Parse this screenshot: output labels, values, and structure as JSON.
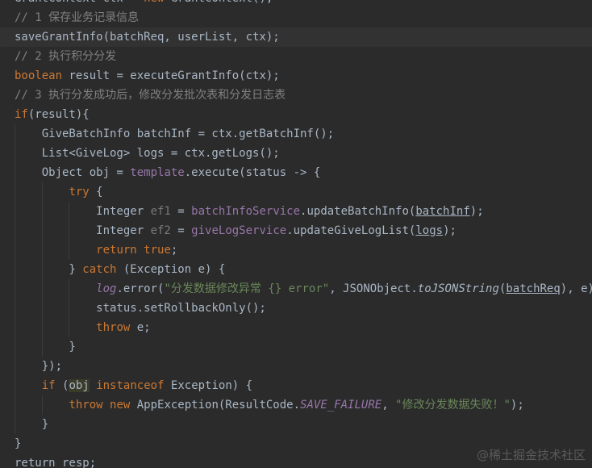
{
  "editor": {
    "lines": [
      [
        {
          "t": "GrantContext ctx = ",
          "c": "text"
        },
        {
          "t": "new ",
          "c": "keyword"
        },
        {
          "t": "GrantContext();",
          "c": "text"
        }
      ],
      [
        {
          "t": "// 1 保存业务记录信息",
          "c": "comment"
        }
      ],
      [
        {
          "t": "saveGrantInfo(batchReq, userList, ctx);",
          "c": "text"
        }
      ],
      [
        {
          "t": "// 2 执行积分分发",
          "c": "comment"
        }
      ],
      [
        {
          "t": "boolean ",
          "c": "keyword"
        },
        {
          "t": "result = executeGrantInfo(ctx);",
          "c": "text"
        }
      ],
      [
        {
          "t": "// 3 执行分发成功后，修改分发批次表和分发日志表",
          "c": "comment"
        }
      ],
      [
        {
          "t": "if",
          "c": "keyword"
        },
        {
          "t": "(result){",
          "c": "text"
        }
      ],
      [
        {
          "t": "    GiveBatchInfo batchInf = ctx.getBatchInf();",
          "c": "text"
        }
      ],
      [
        {
          "t": "    List<GiveLog> logs = ctx.getLogs();",
          "c": "text"
        }
      ],
      [
        {
          "t": "    Object obj = ",
          "c": "text"
        },
        {
          "t": "template",
          "c": "field"
        },
        {
          "t": ".execute(status -> {",
          "c": "text"
        }
      ],
      [
        {
          "t": "        ",
          "c": "text"
        },
        {
          "t": "try ",
          "c": "keyword"
        },
        {
          "t": "{",
          "c": "text"
        }
      ],
      [
        {
          "t": "            Integer ",
          "c": "text"
        },
        {
          "t": "ef1",
          "c": "gray"
        },
        {
          "t": " = ",
          "c": "text"
        },
        {
          "t": "batchInfoService",
          "c": "field"
        },
        {
          "t": ".updateBatchInfo(",
          "c": "text"
        },
        {
          "t": "batchInf",
          "c": "param"
        },
        {
          "t": ");",
          "c": "text"
        }
      ],
      [
        {
          "t": "            Integer ",
          "c": "text"
        },
        {
          "t": "ef2",
          "c": "gray"
        },
        {
          "t": " = ",
          "c": "text"
        },
        {
          "t": "giveLogService",
          "c": "field"
        },
        {
          "t": ".updateGiveLogList(",
          "c": "text"
        },
        {
          "t": "logs",
          "c": "param"
        },
        {
          "t": ");",
          "c": "text"
        }
      ],
      [
        {
          "t": "            ",
          "c": "text"
        },
        {
          "t": "return true",
          "c": "keyword"
        },
        {
          "t": ";",
          "c": "text"
        }
      ],
      [
        {
          "t": "        } ",
          "c": "text"
        },
        {
          "t": "catch ",
          "c": "keyword"
        },
        {
          "t": "(Exception e) {",
          "c": "text"
        }
      ],
      [
        {
          "t": "            ",
          "c": "text"
        },
        {
          "t": "log",
          "c": "const"
        },
        {
          "t": ".error(",
          "c": "text"
        },
        {
          "t": "\"分发数据修改异常 {} error\"",
          "c": "string"
        },
        {
          "t": ", JSONObject.",
          "c": "text"
        },
        {
          "t": "toJSONString",
          "c": "static"
        },
        {
          "t": "(",
          "c": "text"
        },
        {
          "t": "batchReq",
          "c": "param"
        },
        {
          "t": "), e);",
          "c": "text"
        }
      ],
      [
        {
          "t": "            status.setRollbackOnly();",
          "c": "text"
        }
      ],
      [
        {
          "t": "            ",
          "c": "text"
        },
        {
          "t": "throw ",
          "c": "keyword"
        },
        {
          "t": "e;",
          "c": "text"
        }
      ],
      [
        {
          "t": "        }",
          "c": "text"
        }
      ],
      [
        {
          "t": "    });",
          "c": "text"
        }
      ],
      [
        {
          "t": "    ",
          "c": "text"
        },
        {
          "t": "if ",
          "c": "keyword"
        },
        {
          "t": "(",
          "c": "text"
        },
        {
          "t": "obj",
          "c": "highlight"
        },
        {
          "t": " ",
          "c": "text"
        },
        {
          "t": "instanceof ",
          "c": "keyword"
        },
        {
          "t": "Exception) {",
          "c": "text"
        }
      ],
      [
        {
          "t": "        ",
          "c": "text"
        },
        {
          "t": "throw new ",
          "c": "keyword"
        },
        {
          "t": "AppException(ResultCode.",
          "c": "text"
        },
        {
          "t": "SAVE_FAILURE",
          "c": "const"
        },
        {
          "t": ", ",
          "c": "text"
        },
        {
          "t": "\"修改分发数据失败！\"",
          "c": "string"
        },
        {
          "t": ");",
          "c": "text"
        }
      ],
      [
        {
          "t": "    }",
          "c": "text"
        }
      ],
      [
        {
          "t": "}",
          "c": "text"
        }
      ],
      [
        {
          "t": "return resp;",
          "c": "text"
        }
      ]
    ],
    "current_line_index": 2,
    "colors": {
      "background": "#2b2b2b",
      "current_line": "#323232",
      "comment": "#808080",
      "keyword": "#cc7832",
      "text": "#a9b7c6",
      "field": "#9876aa",
      "string": "#6a8759",
      "unused": "#787878"
    }
  },
  "watermark": {
    "text": "@稀土掘金技术社区"
  }
}
